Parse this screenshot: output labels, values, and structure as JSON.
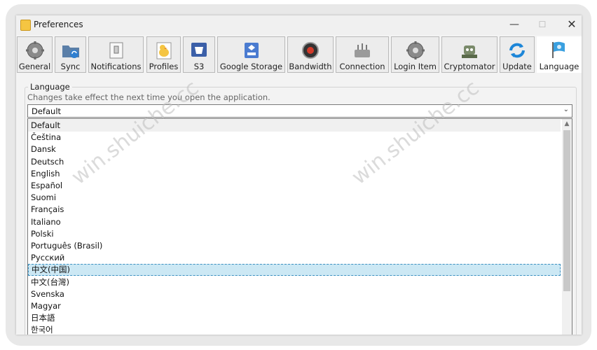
{
  "window": {
    "title": "Preferences",
    "controls": {
      "minimize": "—",
      "maximize": "☐",
      "close": "✕"
    }
  },
  "toolbar": {
    "tabs": [
      {
        "label": "General",
        "icon": "gear-icon"
      },
      {
        "label": "Sync",
        "icon": "sync-folder-icon"
      },
      {
        "label": "Notifications",
        "icon": "notification-switch-icon"
      },
      {
        "label": "Profiles",
        "icon": "profiles-duck-icon"
      },
      {
        "label": "S3",
        "icon": "s3-bucket-icon"
      },
      {
        "label": "Google Storage",
        "icon": "google-storage-icon"
      },
      {
        "label": "Bandwidth",
        "icon": "bandwidth-gauge-icon"
      },
      {
        "label": "Connection",
        "icon": "connection-router-icon"
      },
      {
        "label": "Login Item",
        "icon": "login-gear-icon"
      },
      {
        "label": "Cryptomator",
        "icon": "cryptomator-robot-icon"
      },
      {
        "label": "Update",
        "icon": "update-arrows-icon"
      },
      {
        "label": "Language",
        "icon": "language-flag-icon",
        "active": true
      }
    ]
  },
  "language": {
    "group_title": "Language",
    "hint": "Changes take effect the next time you open the application.",
    "selected_value": "Default",
    "options": [
      "Default",
      "Čeština",
      "Dansk",
      "Deutsch",
      "English",
      "Español",
      "Suomi",
      "Français",
      "Italiano",
      "Polski",
      "Português (Brasil)",
      "Русский",
      "中文(中国)",
      "中文(台灣)",
      "Svenska",
      "Magyar",
      "日本語",
      "한국어"
    ],
    "hovered_option": "Default",
    "highlighted_option": "中文(中国)"
  },
  "watermark": "win.shuiche.cc",
  "colors": {
    "highlight_bg": "#cce8f4",
    "highlight_border": "#3a8fc0",
    "window_bg": "#f3f3f3"
  }
}
